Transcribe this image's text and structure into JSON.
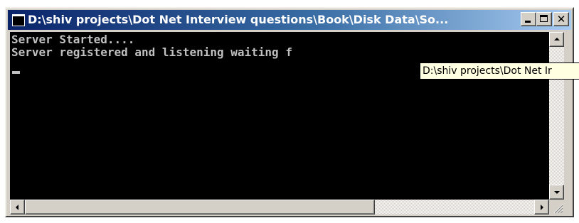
{
  "window": {
    "title": "D:\\shiv projects\\Dot Net Interview questions\\Book\\Disk Data\\So...",
    "icon": "console-window-icon",
    "buttons": {
      "minimize": "minimize-icon",
      "maximize": "maximize-icon",
      "close_glyph": "✕"
    }
  },
  "console": {
    "lines": [
      "Server Started....",
      "Server registered and listening waiting f"
    ],
    "cursor": "_",
    "background": "#000000",
    "foreground": "#c0c0c0"
  },
  "tooltip": {
    "text": "D:\\shiv projects\\Dot Net Ir"
  },
  "scrollbars": {
    "vertical": {
      "up": "arrow-up-icon",
      "down": "arrow-down-icon"
    },
    "horizontal": {
      "left": "arrow-left-icon",
      "right": "arrow-right-icon"
    }
  },
  "colors": {
    "titlebar_start": "#0a246a",
    "titlebar_end": "#a6caf0",
    "chrome": "#d4d0c8",
    "tooltip_bg": "#ffffe1"
  }
}
